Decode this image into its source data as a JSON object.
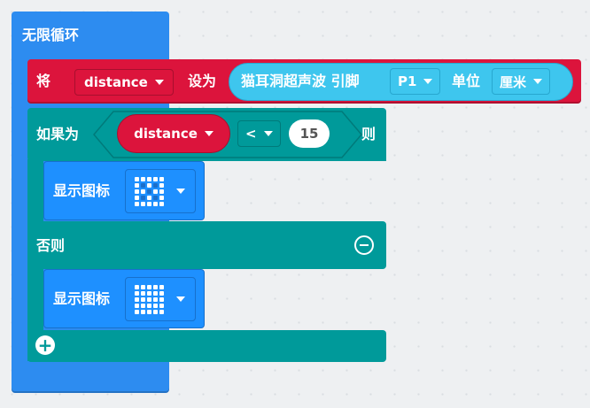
{
  "forever": {
    "label": "无限循环"
  },
  "set_block": {
    "prefix": "将",
    "variable": "distance",
    "infix": "设为",
    "sensor_label": "猫耳洞超声波 引脚",
    "pin": "P1",
    "unit_label": "单位",
    "unit": "厘米"
  },
  "if_block": {
    "if_label": "如果为",
    "variable": "distance",
    "operator": "<",
    "value": "15",
    "then_label": "则",
    "else_label": "否则"
  },
  "show_icon_1": {
    "label": "显示图标",
    "icon_name": "square-icon",
    "pattern": [
      1,
      1,
      1,
      1,
      1,
      1,
      0,
      1,
      0,
      1,
      1,
      1,
      0,
      1,
      1,
      1,
      0,
      1,
      0,
      1,
      1,
      1,
      1,
      1,
      1
    ]
  },
  "show_icon_2": {
    "label": "显示图标",
    "icon_name": "full-grid-icon",
    "pattern": [
      1,
      1,
      1,
      1,
      1,
      1,
      1,
      1,
      1,
      1,
      1,
      1,
      1,
      1,
      1,
      1,
      1,
      1,
      1,
      1,
      1,
      1,
      1,
      1,
      1
    ]
  },
  "colors": {
    "loop_blue": "#2d8cf0",
    "variable_red": "#dc143c",
    "sensor_cyan": "#3ec6ee",
    "logic_teal": "#009a9a",
    "basic_blue": "#1e90ff",
    "workspace": "#eef0f2"
  }
}
